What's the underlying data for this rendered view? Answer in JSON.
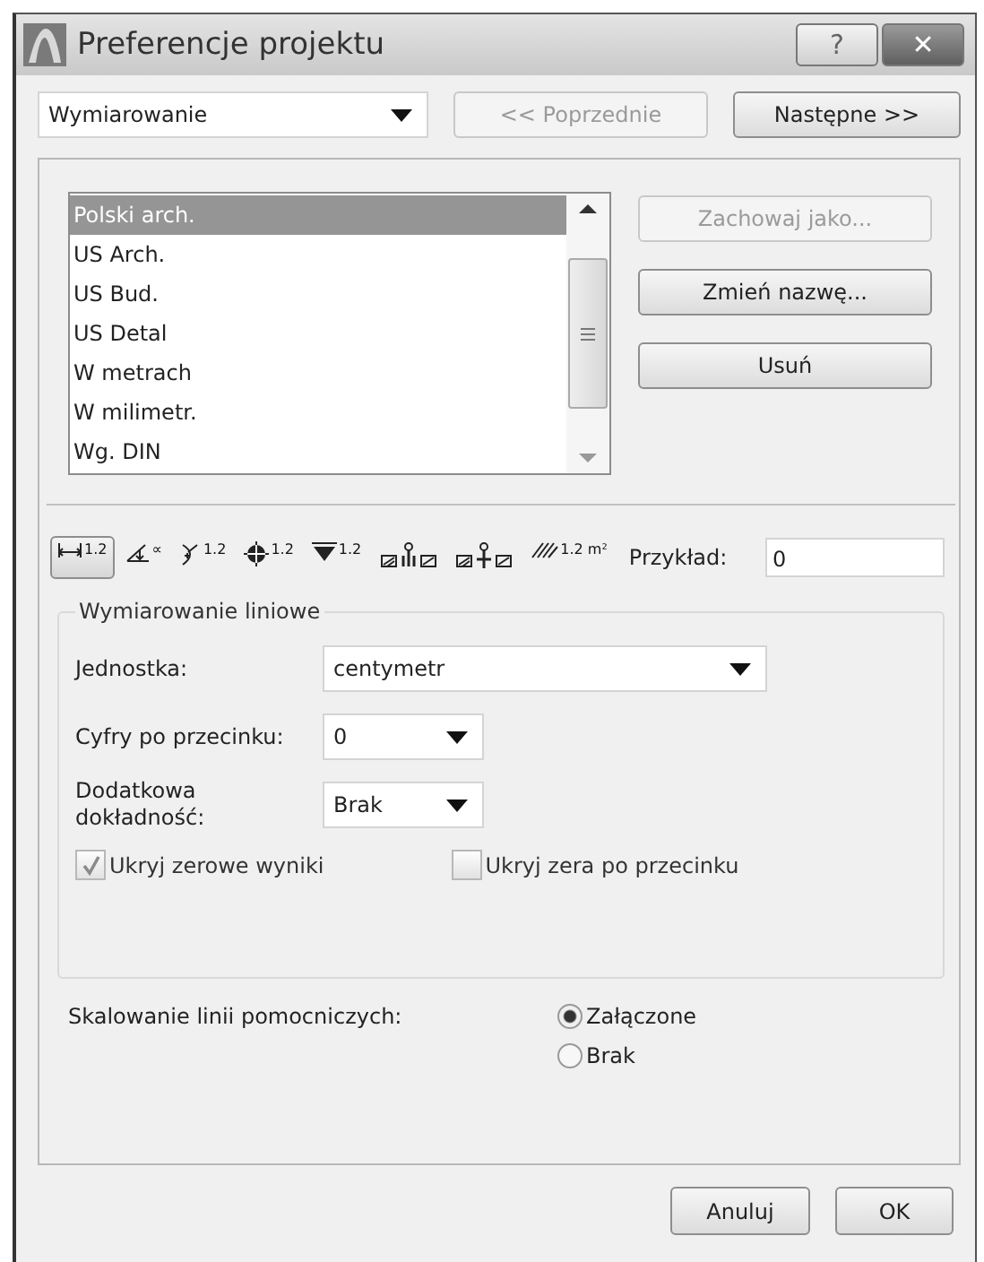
{
  "window": {
    "title": "Preferencje projektu",
    "help": "?",
    "close": "✕"
  },
  "nav": {
    "section": "Wymiarowanie",
    "prev": {
      "label": "<< Poprzednie",
      "disabled": true
    },
    "next": {
      "label": "Następne >>",
      "disabled": false
    }
  },
  "presets": {
    "items": [
      {
        "label": "Polski arch.",
        "selected": true
      },
      {
        "label": "US Arch.",
        "selected": false
      },
      {
        "label": "US Bud.",
        "selected": false
      },
      {
        "label": "US Detal",
        "selected": false
      },
      {
        "label": "W metrach",
        "selected": false
      },
      {
        "label": "W milimetr.",
        "selected": false
      },
      {
        "label": "Wg. DIN",
        "selected": false
      }
    ],
    "buttons": [
      {
        "label": "Zachowaj jako...",
        "disabled": true
      },
      {
        "label": "Zmień nazwę...",
        "disabled": false
      },
      {
        "label": "Usuń",
        "disabled": false
      }
    ]
  },
  "tools": [
    {
      "kind": "linear",
      "label": "1.2",
      "selected": true
    },
    {
      "kind": "angle",
      "label": "∝",
      "selected": false
    },
    {
      "kind": "radius",
      "label": "1.2",
      "selected": false
    },
    {
      "kind": "level",
      "label": "1.2",
      "selected": false
    },
    {
      "kind": "elevation",
      "label": "1.2",
      "selected": false
    },
    {
      "kind": "door",
      "selected": false
    },
    {
      "kind": "sill",
      "selected": false
    },
    {
      "kind": "area",
      "label": "1.2 m²",
      "selected": false
    }
  ],
  "example": {
    "label": "Przykład:",
    "value": "0"
  },
  "group": {
    "title": "Wymiarowanie liniowe",
    "fields": [
      {
        "label": "Jednostka:",
        "value": "centymetr",
        "kind": "wide"
      },
      {
        "label": "Cyfry po przecinku:",
        "value": "0",
        "kind": "narrow"
      },
      {
        "label": "Dodatkowa dokładność:",
        "value": "Brak",
        "kind": "narrow"
      }
    ],
    "checks": [
      {
        "label": "Ukryj zerowe wyniki",
        "checked": true,
        "disabled": true
      },
      {
        "label": "Ukryj zera po przecinku",
        "checked": false,
        "disabled": true
      }
    ]
  },
  "scaling": {
    "label": "Skalowanie linii pomocniczych:",
    "options": [
      {
        "label": "Załączone",
        "selected": true
      },
      {
        "label": "Brak",
        "selected": false
      }
    ]
  },
  "buttons": [
    "Anuluj",
    "OK"
  ]
}
